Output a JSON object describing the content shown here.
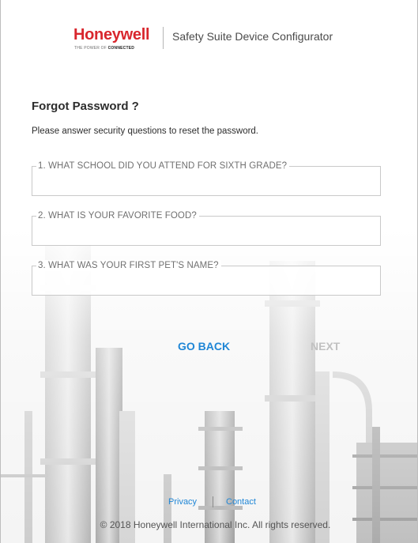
{
  "header": {
    "logo_text": "Honeywell",
    "logo_tagline_prefix": "THE POWER OF ",
    "logo_tagline_bold": "CONNECTED",
    "app_title": "Safety Suite Device Configurator"
  },
  "form": {
    "title": "Forgot Password ?",
    "instructions": "Please answer security questions to reset the password.",
    "questions": [
      {
        "label": "1. WHAT SCHOOL DID YOU ATTEND FOR SIXTH GRADE?",
        "value": "",
        "placeholder": ""
      },
      {
        "label": "2. WHAT IS YOUR FAVORITE FOOD?",
        "value": "",
        "placeholder": ""
      },
      {
        "label": "3. WHAT WAS YOUR FIRST PET'S NAME?",
        "value": "",
        "placeholder": ""
      }
    ]
  },
  "actions": {
    "back_label": "GO BACK",
    "next_label": "NEXT",
    "next_enabled": false
  },
  "footer": {
    "privacy_label": "Privacy",
    "contact_label": "Contact",
    "copyright": "© 2018 Honeywell International Inc. All rights reserved."
  },
  "colors": {
    "brand_red": "#d8262d",
    "link_blue": "#1f86d6",
    "disabled_gray": "#c1c1c1"
  },
  "icons": {
    "background": "industrial-plant-image"
  }
}
